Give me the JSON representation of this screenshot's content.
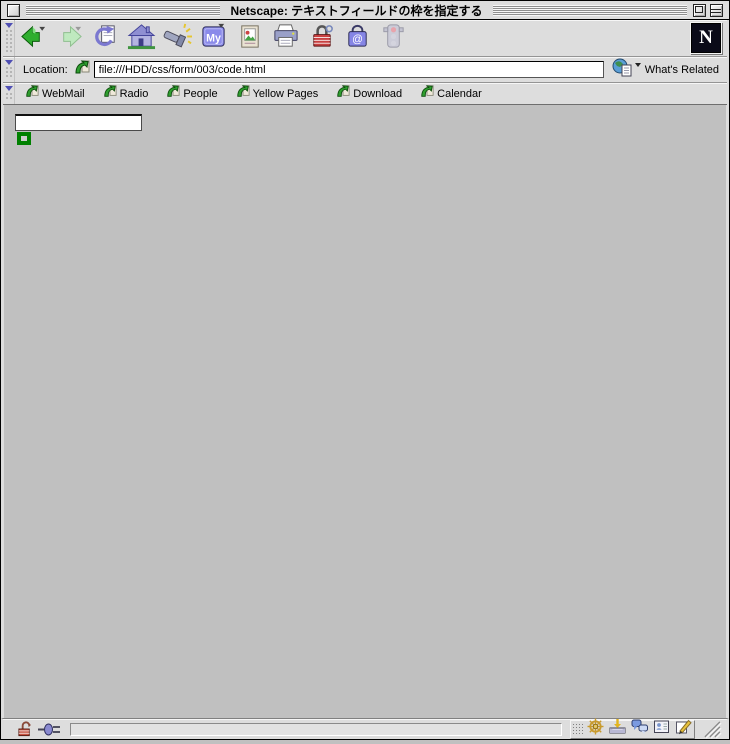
{
  "window": {
    "title": "Netscape: テキストフィールドの枠を指定する"
  },
  "toolbar": {
    "buttons": [
      "back",
      "forward",
      "reload",
      "home",
      "search",
      "my-netscape",
      "images",
      "print",
      "security",
      "shop",
      "stop"
    ],
    "my_netscape_label": "My",
    "shop_symbol": "@",
    "logo_letter": "N"
  },
  "location_bar": {
    "label": "Location:",
    "url": "file:///HDD/css/form/003/code.html",
    "whats_related_label": "What's Related"
  },
  "personal_toolbar": {
    "items": [
      "WebMail",
      "Radio",
      "People",
      "Yellow Pages",
      "Download",
      "Calendar"
    ]
  },
  "content": {
    "text_field_value": "",
    "green_bordered_field_value": "",
    "green_border_color": "#008000",
    "page_background": "#c0c0c0"
  },
  "status_bar": {
    "message": ""
  },
  "component_bar": {
    "icons": [
      "navigator",
      "mailbox",
      "discussions",
      "address-book",
      "composer"
    ]
  },
  "colors": {
    "chrome_background": "#dddddd",
    "field_background": "#ffffff"
  }
}
